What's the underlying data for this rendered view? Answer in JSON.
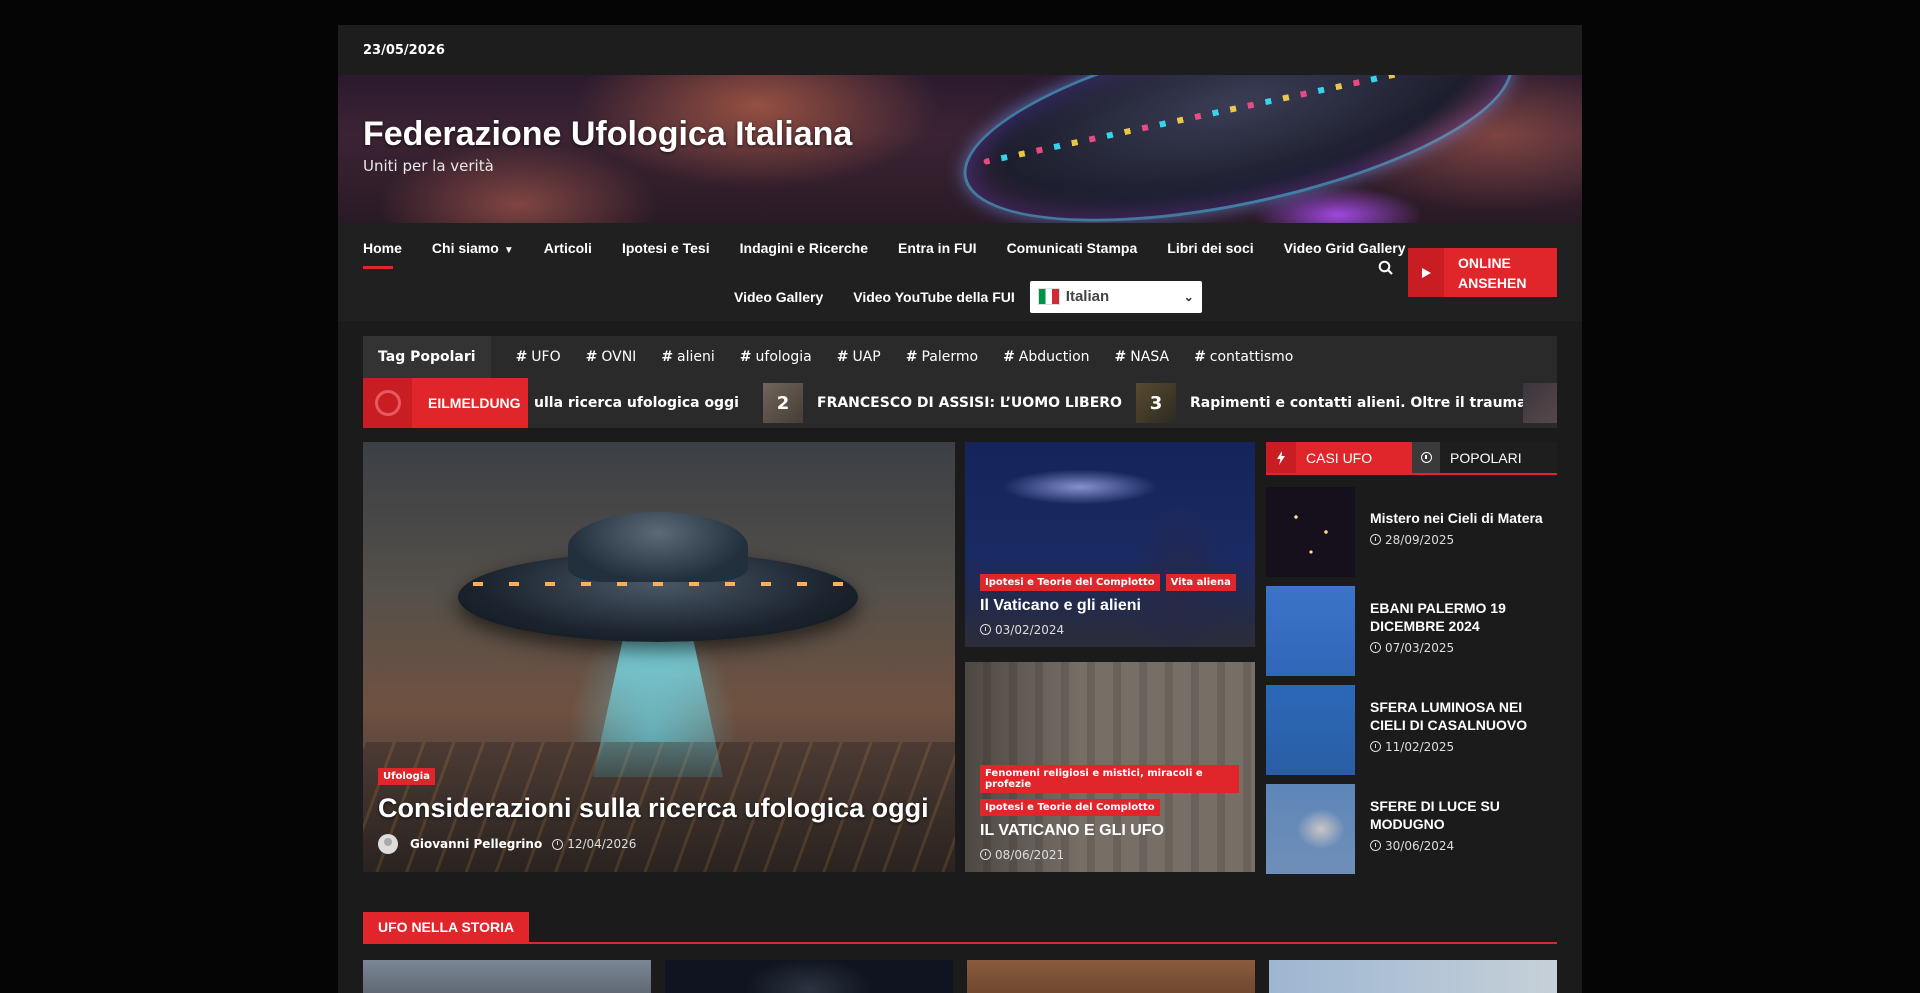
{
  "topbar": {
    "date": "23/05/2026"
  },
  "header": {
    "title": "Federazione Ufologica Italiana",
    "tagline": "Uniti per la verità"
  },
  "nav": {
    "row1": [
      "Home",
      "Chi siamo",
      "Articoli",
      "Ipotesi e Tesi",
      "Indagini e Ricerche",
      "Entra in FUI",
      "Comunicati Stampa",
      "Libri dei soci",
      "Video Grid Gallery"
    ],
    "row2": [
      "Video Gallery",
      "Video YouTube della FUI"
    ],
    "language": "Italian",
    "online_button": [
      "ONLINE",
      "ANSEHEN"
    ]
  },
  "tags": {
    "label": "Tag Popolari",
    "items": [
      "UFO",
      "OVNI",
      "alieni",
      "ufologia",
      "UAP",
      "Palermo",
      "Abduction",
      "NASA",
      "contattismo"
    ]
  },
  "ticker": {
    "label": "EILMELDUNG",
    "items": [
      {
        "num": "",
        "text": "ulla ricerca ufologica oggi"
      },
      {
        "num": "2",
        "text": "FRANCESCO DI ASSISI: L’UOMO LIBERO"
      },
      {
        "num": "3",
        "text": "Rapimenti e contatti alieni. Oltre il trauma"
      }
    ]
  },
  "featured": {
    "category": "Ufologia",
    "title": "Considerazioni sulla ricerca ufologica oggi",
    "author": "Giovanni Pellegrino",
    "date": "12/04/2026"
  },
  "cards": [
    {
      "categories": [
        "Ipotesi e Teorie del Complotto",
        "Vita aliena"
      ],
      "title": "Il Vaticano e gli alieni",
      "date": "03/02/2024"
    },
    {
      "categories": [
        "Fenomeni religiosi e mistici, miracoli e profezie",
        "Ipotesi e Teorie del Complotto"
      ],
      "title": "IL VATICANO E GLI UFO",
      "date": "08/06/2021"
    }
  ],
  "sidebar": {
    "tabs": [
      "CASI UFO",
      "POPOLARI"
    ],
    "items": [
      {
        "title": "Mistero nei Cieli di Matera",
        "date": "28/09/2025"
      },
      {
        "title": "EBANI PALERMO 19 DICEMBRE 2024",
        "date": "07/03/2025"
      },
      {
        "title": "SFERA LUMINOSA NEI CIELI DI CASALNUOVO",
        "date": "11/02/2025"
      },
      {
        "title": "SFERE DI LUCE SU MODUGNO",
        "date": "30/06/2024"
      }
    ]
  },
  "section": {
    "title": "UFO NELLA STORIA"
  },
  "colors": {
    "accent": "#e0262b",
    "background": "#1b1b1b",
    "page": "#050505"
  }
}
